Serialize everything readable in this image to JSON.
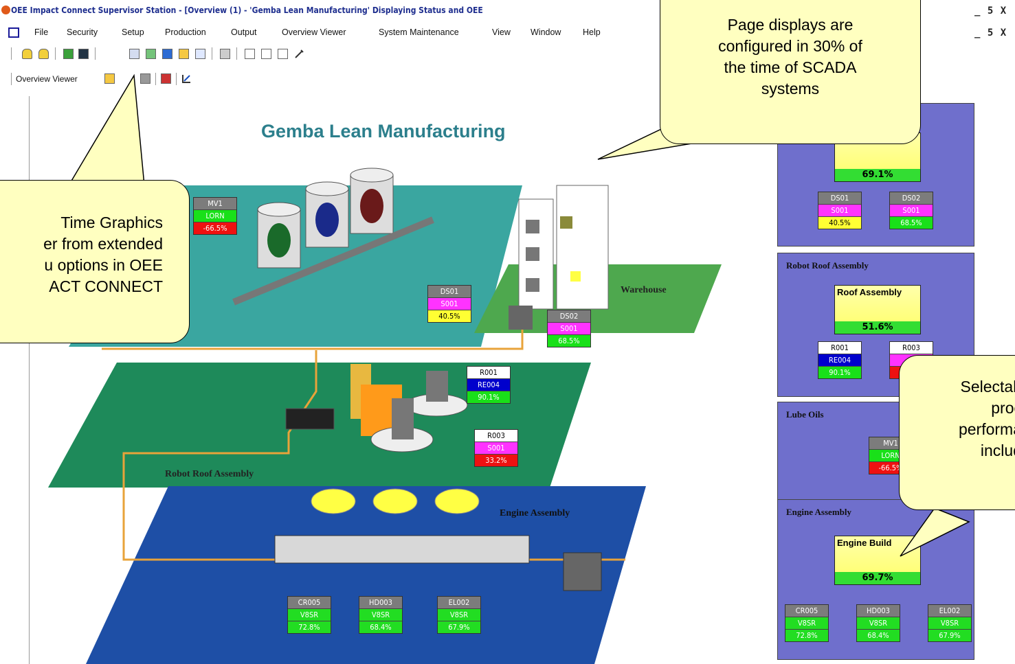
{
  "window": {
    "title": "OEE Impact Connect Supervisor Station - [Overview (1) - 'Gemba Lean Manufacturing' Displaying Status and OEE",
    "controls": "_ 5 X"
  },
  "menu": [
    "File",
    "Security",
    "Setup",
    "Production",
    "Output",
    "Overview Viewer",
    "System Maintenance",
    "View",
    "Window",
    "Help"
  ],
  "toolbar2": {
    "label": "Overview Viewer"
  },
  "diagram": {
    "title": "Gemba Lean Manufacturing",
    "areas": {
      "warehouse": "Warehouse",
      "robot": "Robot Roof Assembly",
      "engine": "Engine Assembly"
    },
    "stations": {
      "mv1": {
        "name": "MV1",
        "code": "LORN",
        "pct": "-66.5%"
      },
      "ds01": {
        "name": "DS01",
        "code": "S001",
        "pct": "40.5%"
      },
      "ds02": {
        "name": "DS02",
        "code": "S001",
        "pct": "68.5%"
      },
      "r001": {
        "name": "R001",
        "code": "RE004",
        "pct": "90.1%"
      },
      "r003": {
        "name": "R003",
        "code": "S001",
        "pct": "33.2%"
      },
      "cr005": {
        "name": "CR005",
        "code": "V8SR",
        "pct": "72.8%"
      },
      "hd003": {
        "name": "HD003",
        "code": "V8SR",
        "pct": "68.4%"
      },
      "el002": {
        "name": "EL002",
        "code": "V8SR",
        "pct": "67.9%"
      }
    }
  },
  "panels": {
    "top": {
      "summary_pct": "69.1%",
      "st1": {
        "name": "DS01",
        "code": "S001",
        "pct": "40.5%"
      },
      "st2": {
        "name": "DS02",
        "code": "S001",
        "pct": "68.5%"
      }
    },
    "robot": {
      "title": "Robot Roof Assembly",
      "summary_label": "Roof Assembly",
      "summary_pct": "51.6%",
      "st1": {
        "name": "R001",
        "code": "RE004",
        "pct": "90.1%"
      },
      "st2_name": "R003"
    },
    "lube": {
      "title": "Lube Oils",
      "st1": {
        "name": "MV1",
        "code": "LORN",
        "pct": "-66.5%"
      }
    },
    "engine": {
      "title": "Engine Assembly",
      "summary_label": "Engine Build",
      "summary_pct": "69.7%",
      "st1": {
        "name": "CR005",
        "code": "V8SR",
        "pct": "72.8%"
      },
      "st2": {
        "name": "HD003",
        "code": "V8SR",
        "pct": "68.4%"
      },
      "st3": {
        "name": "EL002",
        "code": "V8SR",
        "pct": "67.9%"
      }
    }
  },
  "callouts": {
    "top_right": [
      "Page displays are",
      "configured in 30% of",
      "the time of SCADA",
      "systems"
    ],
    "left": [
      "Time Graphics",
      "er from extended",
      "u options in OEE",
      "ACT CONNECT"
    ],
    "bottom_right": [
      "Selectab",
      "proc",
      "performa",
      "includ"
    ]
  }
}
